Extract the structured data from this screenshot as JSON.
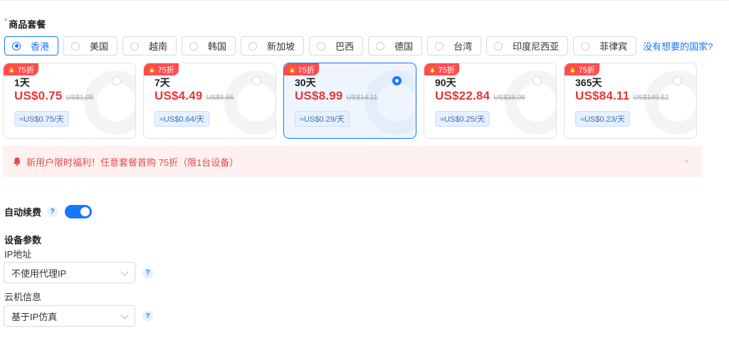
{
  "section": {
    "required_mark": "*",
    "title": "商品套餐"
  },
  "regions": [
    {
      "label": "香港",
      "selected": true
    },
    {
      "label": "美国",
      "selected": false
    },
    {
      "label": "越南",
      "selected": false
    },
    {
      "label": "韩国",
      "selected": false
    },
    {
      "label": "新加坡",
      "selected": false
    },
    {
      "label": "巴西",
      "selected": false
    },
    {
      "label": "德国",
      "selected": false
    },
    {
      "label": "台湾",
      "selected": false
    },
    {
      "label": "印度尼西亚",
      "selected": false
    },
    {
      "label": "菲律宾",
      "selected": false
    }
  ],
  "no_country_link": "没有想要的国家?",
  "plans": [
    {
      "badge": "75折",
      "duration": "1天",
      "price": "US$0.75",
      "original": "US$1.05",
      "daily": "≈US$0.75/天",
      "selected": false
    },
    {
      "badge": "75折",
      "duration": "7天",
      "price": "US$4.49",
      "original": "US$6.66",
      "daily": "≈US$0.64/天",
      "selected": false
    },
    {
      "badge": "75折",
      "duration": "30天",
      "price": "US$8.99",
      "original": "US$14.11",
      "daily": "≈US$0.29/天",
      "selected": true
    },
    {
      "badge": "75折",
      "duration": "90天",
      "price": "US$22.84",
      "original": "US$38.06",
      "daily": "≈US$0.25/天",
      "selected": false
    },
    {
      "badge": "75折",
      "duration": "365天",
      "price": "US$84.11",
      "original": "US$149.52",
      "daily": "≈US$0.23/天",
      "selected": false
    }
  ],
  "promo": {
    "text": "新用户限时福利！任意套餐首购 75折（限1台设备）",
    "close": "×"
  },
  "auto_renew": {
    "label": "自动续费",
    "help": "?",
    "enabled": true
  },
  "device": {
    "title": "设备参数",
    "ip": {
      "label": "IP地址",
      "value": "不使用代理IP",
      "help": "?"
    },
    "cloud": {
      "label": "云机信息",
      "value": "基于IP仿真",
      "help": "?"
    }
  },
  "colors": {
    "accent": "#1677ff",
    "price_red": "#e8363a",
    "badge_red": "#ff4d4f",
    "promo_bg": "#fff1f0"
  },
  "icons": {
    "badge": "fire-icon",
    "promo": "bell-icon",
    "select": "chevron-down-icon",
    "help": "question-icon"
  }
}
